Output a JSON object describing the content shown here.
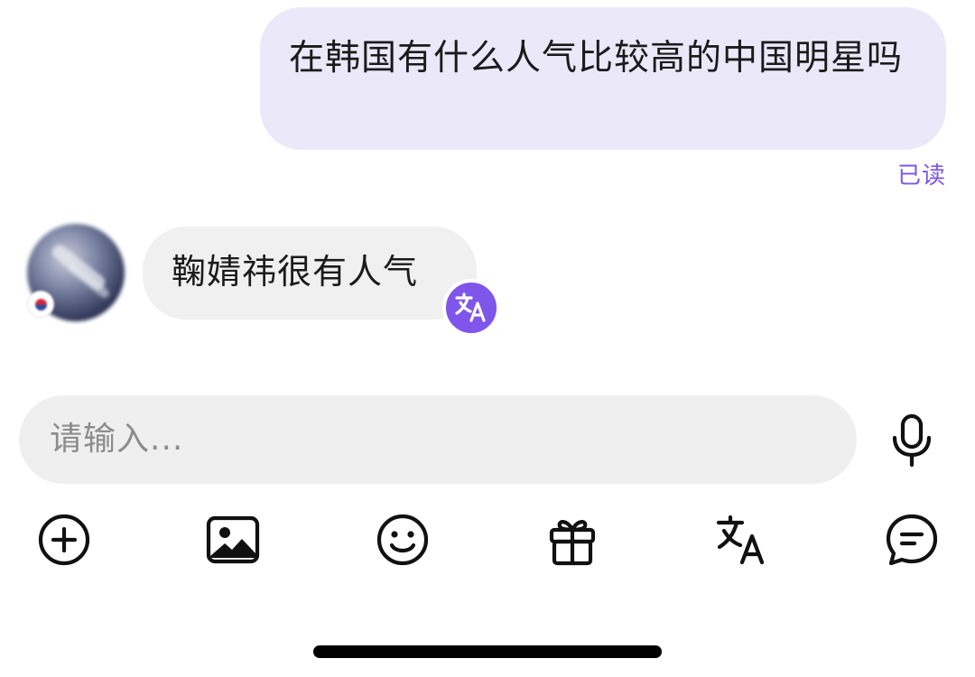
{
  "conversation": {
    "outgoing_message": "在韩国有什么人气比较高的中国明星吗",
    "read_status": "已读",
    "incoming_message": "鞠婧祎很有人气"
  },
  "composer": {
    "placeholder": "请输入..."
  },
  "toolbar": {
    "icons": [
      "add-icon",
      "image-icon",
      "emoji-icon",
      "gift-icon",
      "translate-icon",
      "chat-bubble-icon"
    ]
  },
  "colors": {
    "accent": "#7f55ea",
    "outgoing_bubble": "#ebe8f9",
    "incoming_bubble": "#f0f0f0",
    "input_background": "#efefef"
  }
}
